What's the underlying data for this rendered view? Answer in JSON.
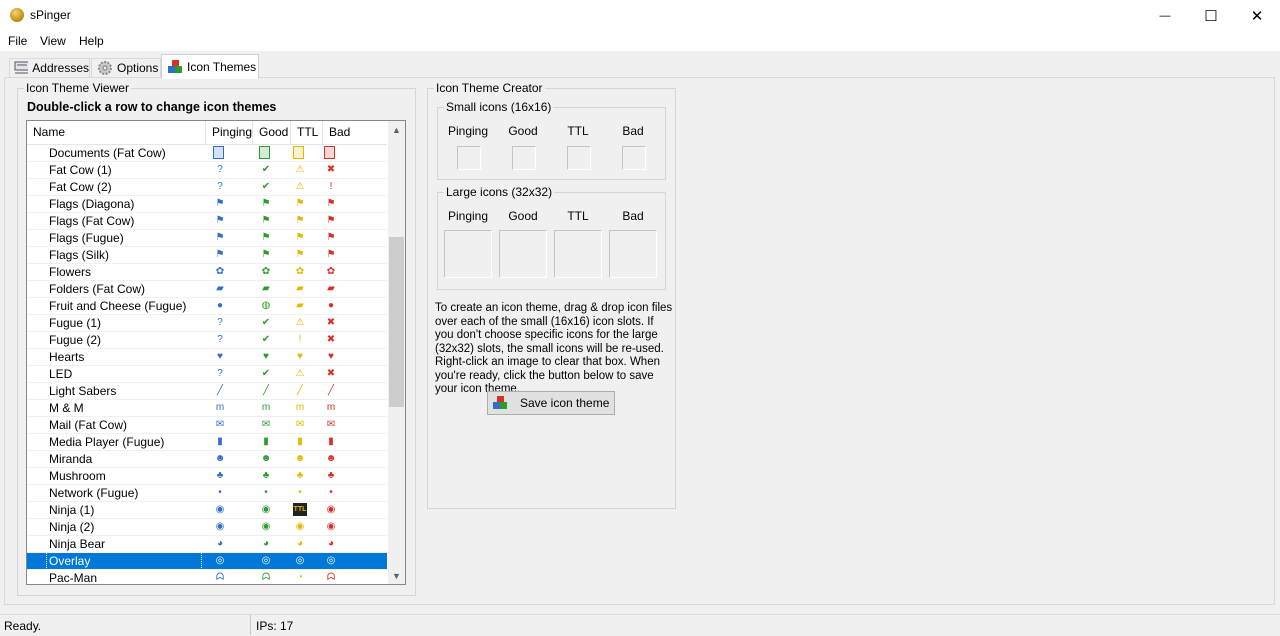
{
  "window": {
    "title": "sPinger",
    "minimize": "—",
    "maximize": "☐",
    "close": "✕"
  },
  "menu": [
    "File",
    "View",
    "Help"
  ],
  "tabs": [
    {
      "label": "Addresses",
      "icon": "network-icon"
    },
    {
      "label": "Options",
      "icon": "gear-icon"
    },
    {
      "label": "Icon Themes",
      "icon": "blocks-icon",
      "active": true
    }
  ],
  "viewer": {
    "group_title": "Icon Theme Viewer",
    "instruction": "Double-click a row to change icon themes",
    "columns": [
      "Name",
      "Pinging",
      "Good",
      "TTL",
      "Bad"
    ],
    "rows": [
      {
        "name": "Documents (Fat Cow)",
        "icons": [
          "doc",
          "doc",
          "doc",
          "doc"
        ]
      },
      {
        "name": "Fat Cow (1)",
        "icons": [
          "?",
          "✔",
          "⚠",
          "✖"
        ]
      },
      {
        "name": "Fat Cow (2)",
        "icons": [
          "?",
          "✔",
          "⚠",
          "!"
        ]
      },
      {
        "name": "Flags (Diagona)",
        "icons": [
          "⚑",
          "⚑",
          "⚑",
          "⚑"
        ]
      },
      {
        "name": "Flags (Fat Cow)",
        "icons": [
          "⚑",
          "⚑",
          "⚑",
          "⚑"
        ]
      },
      {
        "name": "Flags (Fugue)",
        "icons": [
          "⚑",
          "⚑",
          "⚑",
          "⚑"
        ]
      },
      {
        "name": "Flags (Silk)",
        "icons": [
          "⚑",
          "⚑",
          "⚑",
          "⚑"
        ]
      },
      {
        "name": "Flowers",
        "icons": [
          "✿",
          "✿",
          "✿",
          "✿"
        ]
      },
      {
        "name": "Folders (Fat Cow)",
        "icons": [
          "▰",
          "▰",
          "▰",
          "▰"
        ]
      },
      {
        "name": "Fruit and Cheese (Fugue)",
        "icons": [
          "●",
          "◍",
          "▰",
          "●"
        ]
      },
      {
        "name": "Fugue (1)",
        "icons": [
          "?",
          "✔",
          "⚠",
          "✖"
        ]
      },
      {
        "name": "Fugue (2)",
        "icons": [
          "?",
          "✔",
          "!",
          "✖"
        ]
      },
      {
        "name": "Hearts",
        "icons": [
          "♥",
          "♥",
          "♥",
          "♥"
        ]
      },
      {
        "name": "LED",
        "icons": [
          "?",
          "✔",
          "⚠",
          "✖"
        ]
      },
      {
        "name": "Light Sabers",
        "icons": [
          "╱",
          "╱",
          "╱",
          "╱"
        ]
      },
      {
        "name": "M & M",
        "icons": [
          "m",
          "m",
          "m",
          "m"
        ]
      },
      {
        "name": "Mail (Fat Cow)",
        "icons": [
          "✉",
          "✉",
          "✉",
          "✉"
        ]
      },
      {
        "name": "Media Player (Fugue)",
        "icons": [
          "▮",
          "▮",
          "▮",
          "▮"
        ]
      },
      {
        "name": "Miranda",
        "icons": [
          "☻",
          "☻",
          "☻",
          "☻"
        ]
      },
      {
        "name": "Mushroom",
        "icons": [
          "♣",
          "♣",
          "♣",
          "♣"
        ]
      },
      {
        "name": "Network (Fugue)",
        "icons": [
          "•",
          "•",
          "•",
          "•"
        ]
      },
      {
        "name": "Ninja (1)",
        "icons": [
          "◉",
          "◉",
          "TTL",
          "◉"
        ]
      },
      {
        "name": "Ninja (2)",
        "icons": [
          "◉",
          "◉",
          "◉",
          "◉"
        ]
      },
      {
        "name": "Ninja Bear",
        "icons": [
          "◕",
          "◕",
          "◕",
          "◕"
        ]
      },
      {
        "name": "Overlay",
        "icons": [
          "◎",
          "◎",
          "◎",
          "◎"
        ],
        "selected": true
      },
      {
        "name": "Pac-Man",
        "icons": [
          "ᗣ",
          "ᗣ",
          "◔",
          "ᗣ"
        ]
      }
    ],
    "icon_colors": {
      "pinging": "#2f6fc9",
      "good": "#2e9b2e",
      "ttl": "#e5b800",
      "bad": "#d93025"
    }
  },
  "creator": {
    "group_title": "Icon Theme Creator",
    "small": {
      "title": "Small icons (16x16)",
      "labels": [
        "Pinging",
        "Good",
        "TTL",
        "Bad"
      ]
    },
    "large": {
      "title": "Large icons (32x32)",
      "labels": [
        "Pinging",
        "Good",
        "TTL",
        "Bad"
      ]
    },
    "help_text": "To create an icon theme, drag & drop icon files over each of the small (16x16) icon slots.  If you don't choose specific icons for the large (32x32) slots, the small icons will be re-used.  Right-click an image to clear that box.  When you're ready, click the button below to save your icon theme.",
    "save_button": "Save icon theme"
  },
  "status": {
    "text": "Ready.",
    "ips": "IPs: 17"
  }
}
